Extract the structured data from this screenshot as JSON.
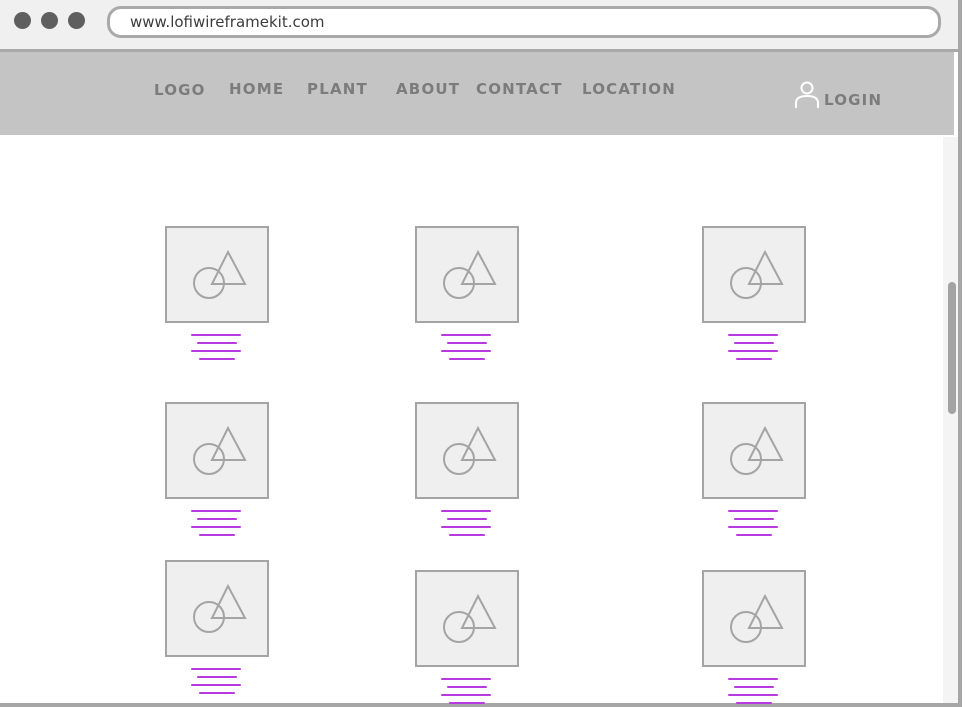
{
  "browser": {
    "url": "www.lofiwireframekit.com"
  },
  "nav": {
    "logo": "LOGO",
    "home": "HOME",
    "plant": "PLANT",
    "about": "ABOUT",
    "contact": "CONTACT",
    "location": "LOCATION",
    "login": "LOGIN"
  },
  "icons": {
    "user": "user-icon",
    "placeholder": "image-placeholder-icon"
  },
  "colors": {
    "navbar": "#c4c4c4",
    "caption_lines": "#b73be0",
    "placeholder_bg": "#efefef"
  },
  "grid": {
    "rows": 3,
    "columns": 3
  }
}
